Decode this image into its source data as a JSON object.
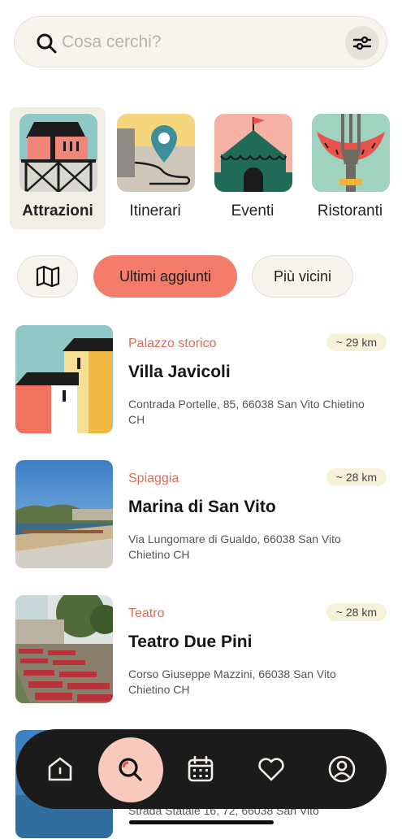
{
  "search": {
    "placeholder": "Cosa cerchi?"
  },
  "categories": [
    {
      "label": "Attrazioni",
      "active": true
    },
    {
      "label": "Itinerari",
      "active": false
    },
    {
      "label": "Eventi",
      "active": false
    },
    {
      "label": "Ristoranti",
      "active": false
    }
  ],
  "filters": {
    "map_icon": "map-icon",
    "latest_label": "Ultimi aggiunti",
    "nearest_label": "Più vicini"
  },
  "results": [
    {
      "category": "Palazzo storico",
      "distance": "~ 29 km",
      "title": "Villa Javicoli",
      "address": "Contrada Portelle, 85, 66038 San Vito Chietino CH"
    },
    {
      "category": "Spiaggia",
      "distance": "~ 28 km",
      "title": "Marina di San Vito",
      "address": "Via Lungomare di Gualdo, 66038 San Vito Chietino CH"
    },
    {
      "category": "Teatro",
      "distance": "~ 28 km",
      "title": "Teatro Due Pini",
      "address": "Corso Giuseppe Mazzini, 66038 San Vito Chietino CH"
    },
    {
      "address": "Strada Statale 16, 72, 66038 San Vito"
    }
  ],
  "nav": {
    "items": [
      "home-icon",
      "search-icon",
      "calendar-icon",
      "heart-icon",
      "profile-icon"
    ],
    "active": "search-icon"
  },
  "colors": {
    "accent": "#f37d6a",
    "category_text": "#e06a57",
    "nav_bg": "#1b1b1b",
    "nav_active": "#f8cabd",
    "surface": "#f6f4ec"
  }
}
